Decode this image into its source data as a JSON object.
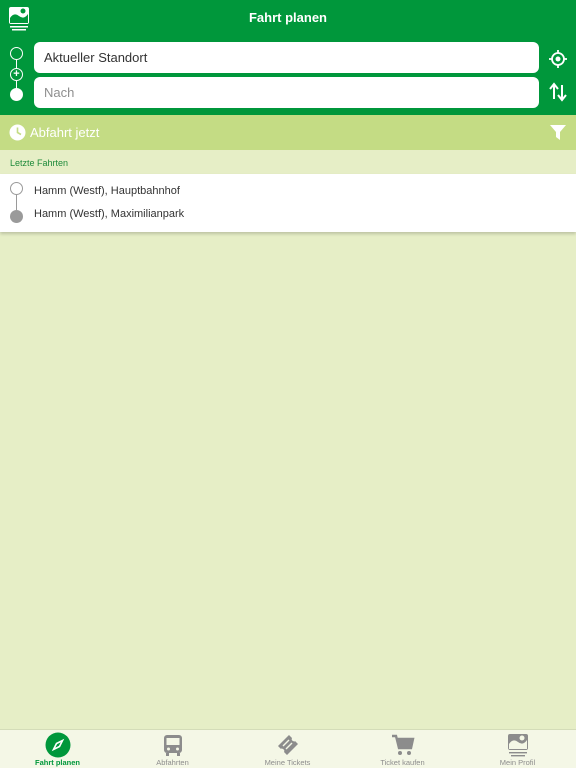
{
  "header": {
    "title": "Fahrt planen"
  },
  "search": {
    "from_value": "Aktueller Standort",
    "to_placeholder": "Nach"
  },
  "departure": {
    "label": "Abfahrt jetzt"
  },
  "recent": {
    "section_label": "Letzte Fahrten",
    "trips": [
      {
        "from": "Hamm (Westf), Hauptbahnhof",
        "to": "Hamm (Westf), Maximilianpark"
      }
    ]
  },
  "tabbar": {
    "items": [
      {
        "label": "Fahrt planen",
        "icon": "compass-icon",
        "active": true
      },
      {
        "label": "Abfahrten",
        "icon": "bus-icon",
        "active": false
      },
      {
        "label": "Meine Tickets",
        "icon": "ticket-icon",
        "active": false
      },
      {
        "label": "Ticket kaufen",
        "icon": "cart-icon",
        "active": false
      },
      {
        "label": "Mein Profil",
        "icon": "profile-logo-icon",
        "active": false
      }
    ]
  },
  "colors": {
    "primary": "#00973b",
    "secondary": "#c4dc84",
    "background": "#e6eec6",
    "inactive": "#8c8c8c"
  }
}
